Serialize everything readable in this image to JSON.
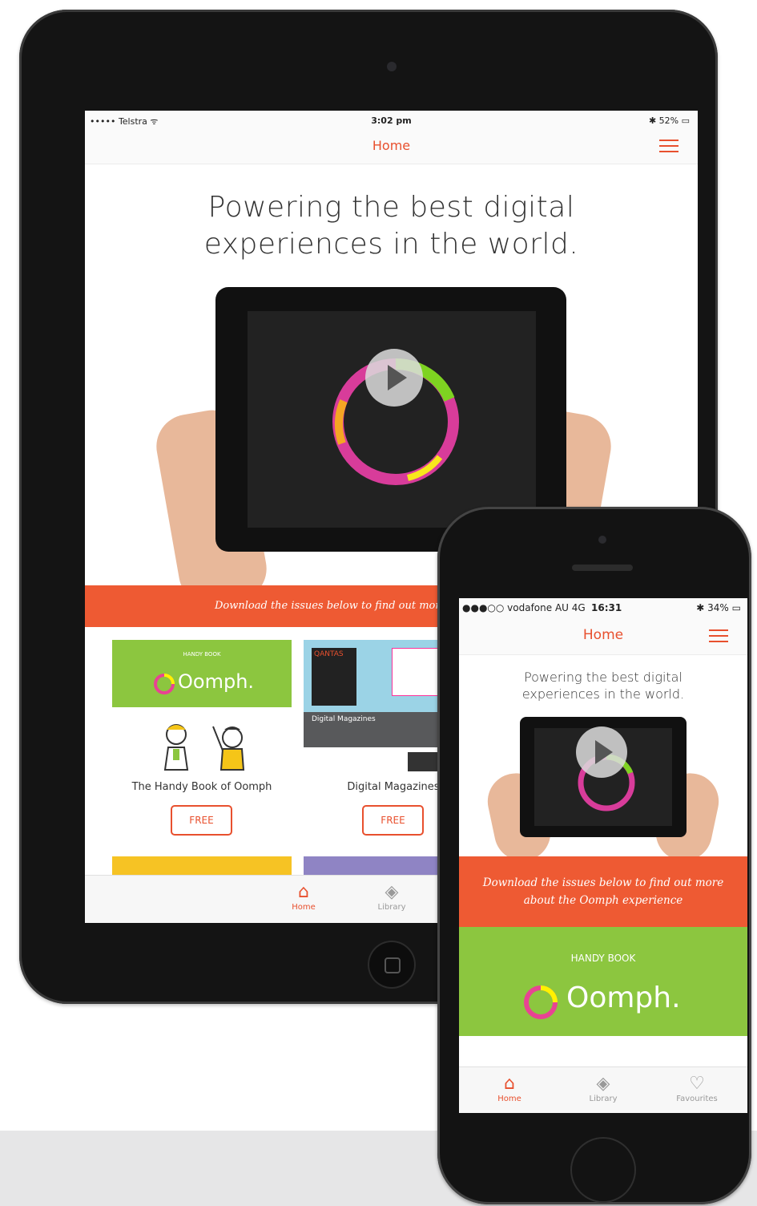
{
  "colors": {
    "accent": "#e8502e",
    "banner": "#ee5a33",
    "green": "#8cc63f"
  },
  "ipad": {
    "status": {
      "carrier": "••••• Telstra ᯤ",
      "time": "3:02 pm",
      "battery": "✱ 52% ▭"
    },
    "nav": {
      "title": "Home",
      "menu_icon": "hamburger-icon"
    },
    "headline": {
      "line1": "Powering the best digital",
      "line2": "experiences in the world."
    },
    "banner": "Download the issues below to find out more about",
    "cards": [
      {
        "title": "The Handy Book of Oomph",
        "thumb_small": "HANDY BOOK",
        "thumb_logo": "Oomph.",
        "button": "FREE"
      },
      {
        "title": "Digital Magazines",
        "thumb_caption": "Digital Magazines",
        "thumb_cover": "QANTAS",
        "button": "FREE"
      }
    ],
    "tabs": [
      {
        "label": "Home",
        "icon": "home-icon"
      },
      {
        "label": "Library",
        "icon": "library-icon"
      }
    ]
  },
  "iphone": {
    "status": {
      "carrier": "●●●○○ vodafone AU  4G",
      "time": "16:31",
      "battery": "✱ 34% ▭"
    },
    "nav": {
      "title": "Home",
      "menu_icon": "hamburger-icon"
    },
    "headline": {
      "line1": "Powering the best digital",
      "line2": "experiences in the world."
    },
    "banner": {
      "line1": "Download the issues below to find out more",
      "line2": "about the Oomph experience"
    },
    "oomph": {
      "small": "HANDY BOOK",
      "logo": "Oomph."
    },
    "tabs": [
      {
        "label": "Home",
        "icon": "home-icon"
      },
      {
        "label": "Library",
        "icon": "library-icon"
      },
      {
        "label": "Favourites",
        "icon": "heart-icon"
      }
    ]
  }
}
